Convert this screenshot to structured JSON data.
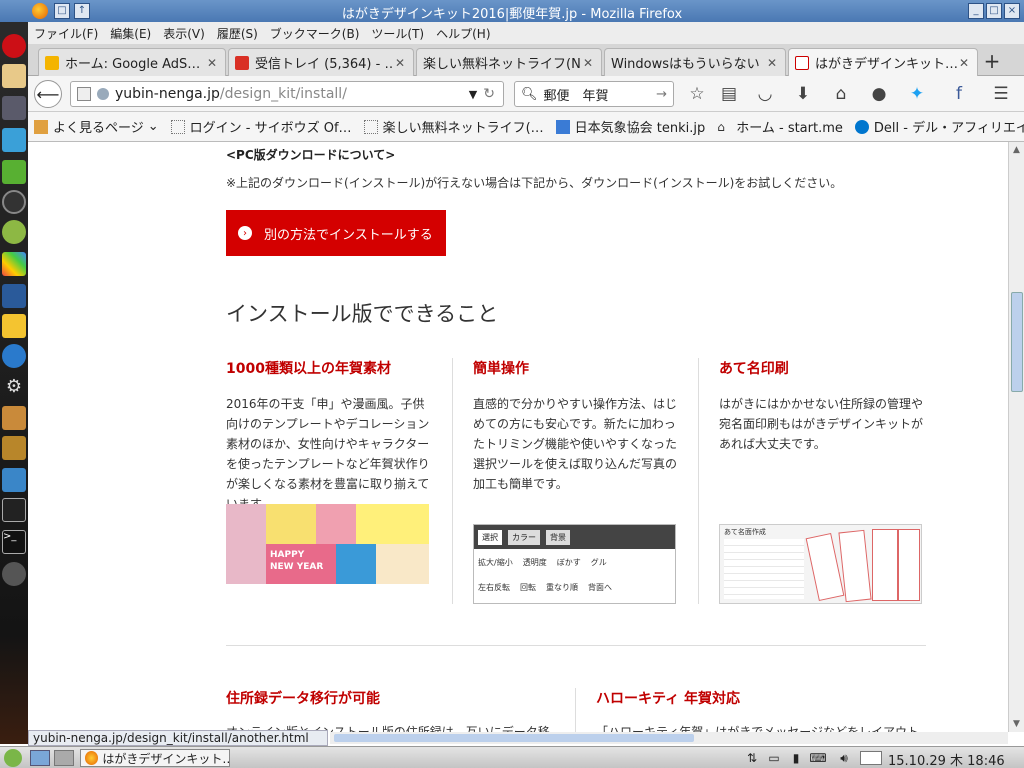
{
  "window": {
    "title": "はがきデザインキット2016|郵便年賀.jp - Mozilla Firefox"
  },
  "menu": [
    "ファイル(F)",
    "編集(E)",
    "表示(V)",
    "履歴(S)",
    "ブックマーク(B)",
    "ツール(T)",
    "ヘルプ(H)"
  ],
  "tabs": [
    {
      "label": "ホーム: Google AdS…",
      "icon": "adsense-icon",
      "color": "#f4b400"
    },
    {
      "label": "受信トレイ (5,364) - …",
      "icon": "gmail-icon",
      "color": "#d93025"
    },
    {
      "label": "楽しい無料ネットライフ(N…",
      "icon": "page-icon",
      "color": "#ffffff"
    },
    {
      "label": "Windowsはもういらない",
      "icon": "page-icon",
      "color": "#ffffff"
    },
    {
      "label": "はがきデザインキット…",
      "icon": "page-red-icon",
      "color": "#ffffff"
    }
  ],
  "nav": {
    "url_host": "yubin-nenga.jp",
    "url_path": "/design_kit/install/",
    "search": "郵便　年賀"
  },
  "bookmarks": [
    "よく見るページ",
    "ログイン - サイボウズ Of…",
    "楽しい無料ネットライフ(…",
    "日本気象協会 tenki.jp",
    "ホーム - start.me",
    "Dell - デル・アフィリエイ…"
  ],
  "page": {
    "pc_heading": "<PC版ダウンロードについて>",
    "notice": "※上記のダウンロード(インストール)が行えない場合は下記から、ダウンロード(インストール)をお試しください。",
    "alt_button": "別の方法でインストールする",
    "section_title": "インストール版でできること",
    "features": [
      {
        "title": "1000種類以上の年賀素材",
        "body": "2016年の干支「申」や漫画風。子供向けのテンプレートやデコレーション素材のほか、女性向けやキャラクターを使ったテンプレートなど年賀状作りが楽しくなる素材を豊富に取り揃えています。"
      },
      {
        "title": "簡単操作",
        "body": "直感的で分かりやすい操作方法、はじめての方にも安心です。新たに加わったトリミング機能や使いやすくなった選択ツールを使えば取り込んだ写真の加工も簡単です。"
      },
      {
        "title": "あて名印刷",
        "body": "はがきにはかかせない住所録の管理や宛名面印刷もはがきデザインキットがあれば大丈夫です。"
      }
    ],
    "feature_img_texts": {
      "happy": "HAPPY",
      "new_year": "NEW YEAR",
      "tool": [
        "選択",
        "カラー",
        "背景",
        "拡大/縮小",
        "透明度",
        "ぼかす",
        "グル",
        "左右反転",
        "回転",
        "重なり順",
        "背面へ"
      ],
      "address": "あて名面作成"
    },
    "bottom": [
      {
        "title": "住所録データ移行が可能",
        "body": "オンライン版とインストール版の住所録は、互いにデータ移行することができます。"
      },
      {
        "title": "ハローキティ 年賀対応",
        "body": "「ハローキティ年賀」はがきでメッセージなどをレイアウト印刷することができます。"
      }
    ]
  },
  "status_url": "yubin-nenga.jp/design_kit/install/another.html",
  "taskbar": {
    "window_label": "はがきデザインキット…",
    "clock": "15.10.29 木 18:46"
  },
  "colors": {
    "accent_red": "#c00000",
    "titlebar": "#4a78b3"
  }
}
